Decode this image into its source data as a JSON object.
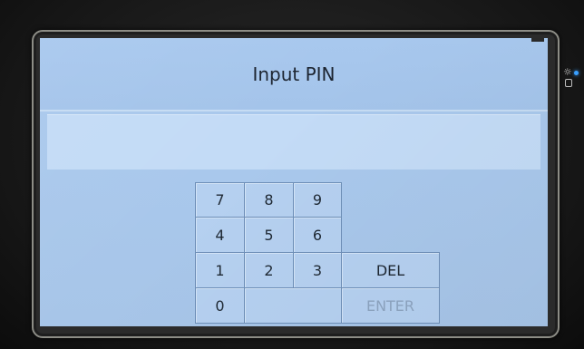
{
  "screen": {
    "title": "Input PIN",
    "pin_value": ""
  },
  "keypad": {
    "keys": [
      {
        "label": "7"
      },
      {
        "label": "8"
      },
      {
        "label": "9"
      },
      {
        "label": "4"
      },
      {
        "label": "5"
      },
      {
        "label": "6"
      },
      {
        "label": "1"
      },
      {
        "label": "2"
      },
      {
        "label": "3"
      },
      {
        "label": "DEL"
      },
      {
        "label": "0"
      },
      {
        "label": ""
      },
      {
        "label": "ENTER"
      }
    ]
  },
  "colors": {
    "screen_bg": "#a9c8ec",
    "key_bg": "#b5d0f0",
    "key_border": "#6e8fb8",
    "enter_disabled_text": "#8da4c0",
    "status_led": "#39a0ff"
  },
  "icons": {
    "brightness": "sun-icon",
    "status": "led-indicator-icon",
    "lock": "lock-icon"
  }
}
